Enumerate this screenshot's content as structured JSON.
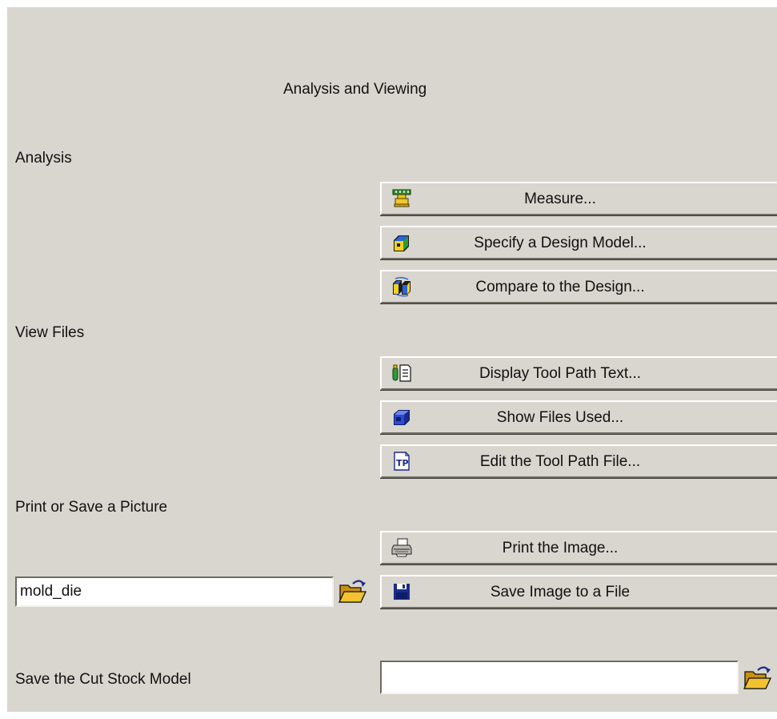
{
  "title": "Analysis  and Viewing",
  "sections": {
    "analysis": "Analysis",
    "view_files": "View Files",
    "print_save": "Print or Save a Picture",
    "cut_stock": "Save the Cut Stock Model"
  },
  "buttons": {
    "measure": {
      "label": "Measure...",
      "icon": "measure-icon"
    },
    "specify_design": {
      "label": "Specify a Design Model...",
      "icon": "design-model-icon"
    },
    "compare_design": {
      "label": "Compare to the Design...",
      "icon": "compare-icon"
    },
    "display_toolpath_text": {
      "label": "Display Tool Path Text...",
      "icon": "toolpath-text-icon"
    },
    "show_files_used": {
      "label": "Show Files Used...",
      "icon": "files-used-icon"
    },
    "edit_toolpath_file": {
      "label": "Edit the Tool Path File...",
      "icon": "tp-file-icon"
    },
    "print_image": {
      "label": "Print the Image...",
      "icon": "printer-icon"
    },
    "save_image": {
      "label": "Save Image to a File",
      "icon": "floppy-disk-icon"
    }
  },
  "inputs": {
    "picture_filename": {
      "value": "mold_die",
      "placeholder": ""
    },
    "cut_stock_filename": {
      "value": "",
      "placeholder": ""
    }
  },
  "colors": {
    "panel_bg": "#d9d5cf",
    "folder": "#f2c230",
    "disk": "#1a2a8c"
  }
}
